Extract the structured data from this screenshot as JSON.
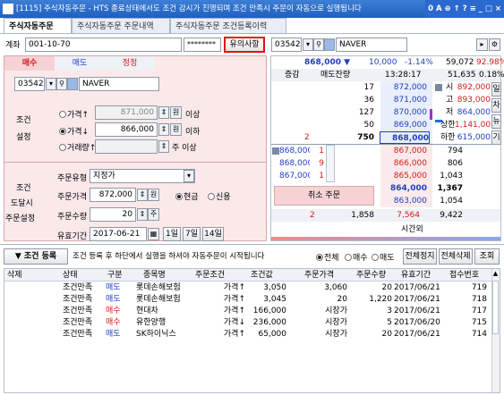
{
  "window": {
    "title": "[1115] 주식자동주문 - HTS 종료상태에서도 조건 감시가 진행되며 조건 만족시 주문이 자동으로 실행됩니다",
    "controls": "0 A ⊕ ↑ ? ≡ _ □ ×"
  },
  "tabs": [
    "주식자동주문",
    "주식자동주문 주문내역",
    "주식자동주문 조건등록이력"
  ],
  "account": {
    "label": "계좌",
    "number": "001-10-70",
    "password": "********",
    "notice_button": "유의사항"
  },
  "right_top": {
    "code": "035420",
    "name": "NAVER"
  },
  "order_tabs": [
    "매수",
    "매도",
    "정정"
  ],
  "left_code": {
    "code": "035420",
    "name": "NAVER"
  },
  "condition": {
    "label1": "조건",
    "label2": "설정",
    "rows": [
      {
        "radio": "가격↑",
        "value": "871,000",
        "unit": "원",
        "suffix": "이상",
        "selected": false
      },
      {
        "radio": "가격↓",
        "value": "866,000",
        "unit": "원",
        "suffix": "이하",
        "selected": true
      },
      {
        "radio": "거래량↑",
        "value": "",
        "unit": "",
        "suffix": "주 이상",
        "selected": false
      }
    ]
  },
  "order": {
    "label1": "조건",
    "label2": "도달시",
    "label3": "주문설정",
    "type_label": "주문유형",
    "type_value": "지정가",
    "price_label": "주문가격",
    "price_value": "872,000",
    "price_unit": "원",
    "cash": "현금",
    "credit": "신용",
    "qty_label": "주문수량",
    "qty_value": "20",
    "qty_unit": "주",
    "valid_label": "유효기간",
    "valid_value": "2017-06-21",
    "d1": "1일",
    "d7": "7일",
    "d14": "14일"
  },
  "quote": {
    "price": "868,000",
    "arrow": "▼",
    "change": "10,000",
    "rate": "-1.14%",
    "volume": "59,072",
    "ratio": "92.98%",
    "hdr": [
      "증감",
      "매도잔량",
      "13:28:17",
      "51,635",
      "0.18%"
    ],
    "asks": [
      {
        "qty": "17",
        "price": "872,000"
      },
      {
        "qty": "36",
        "price": "871,000"
      },
      {
        "qty": "127",
        "price": "870,000"
      },
      {
        "qty": "50",
        "price": "869,000"
      },
      {
        "qty": "750",
        "price": "868,000",
        "inc": "2"
      }
    ],
    "info": [
      {
        "k": "시",
        "v": "892,000"
      },
      {
        "k": "고",
        "v": "893,000"
      },
      {
        "k": "저",
        "v": "864,000"
      },
      {
        "k": "상한",
        "v": "1,141,000"
      },
      {
        "k": "하한",
        "v": "615,000"
      }
    ],
    "side_tabs": [
      "일",
      "차",
      "뉴",
      "기"
    ],
    "trades": [
      {
        "p": "868,000",
        "q": "1"
      },
      {
        "p": "868,000",
        "q": "9"
      },
      {
        "p": "867,000",
        "q": "1"
      }
    ],
    "bids": [
      {
        "price": "867,000",
        "qty": "794"
      },
      {
        "price": "866,000",
        "qty": "806"
      },
      {
        "price": "865,000",
        "qty": "1,043"
      },
      {
        "price": "864,000",
        "qty": "1,367"
      },
      {
        "price": "863,000",
        "qty": "1,054"
      }
    ],
    "cancel_button": "취소 주문",
    "foot": {
      "inc": "2",
      "ask_total": "1,858",
      "diff": "7,564",
      "bid_total": "9,422",
      "after": "시간외"
    }
  },
  "register": {
    "title": "▼ 조건 등록",
    "desc": "조건 등록 후 하단에서 실행을 하셔야 자동주문이 시작됩니다",
    "filters": [
      "전체",
      "매수",
      "매도"
    ],
    "stop": "전체정지",
    "del": "전체삭제",
    "query": "조회"
  },
  "table": {
    "headers": [
      "삭제",
      "상태",
      "구분",
      "종목명",
      "주문조건",
      "조건값",
      "주문가격",
      "주문수량",
      "유효기간",
      "접수번호"
    ],
    "rows": [
      [
        "",
        "조건만족",
        "매도",
        "롯데손해보험",
        "가격↑",
        "3,050",
        "3,060",
        "20",
        "2017/06/21",
        "719"
      ],
      [
        "",
        "조건만족",
        "매도",
        "롯데손해보험",
        "가격↑",
        "3,045",
        "20",
        "1,220",
        "2017/06/21",
        "718"
      ],
      [
        "",
        "조건만족",
        "매수",
        "현대차",
        "가격↑",
        "166,000",
        "시장가",
        "3",
        "2017/06/21",
        "717"
      ],
      [
        "",
        "조건만족",
        "매수",
        "유한양행",
        "가격↓",
        "236,000",
        "시장가",
        "5",
        "2017/06/20",
        "715"
      ],
      [
        "",
        "조건만족",
        "매도",
        "SK하이닉스",
        "가격↑",
        "65,000",
        "시장가",
        "20",
        "2017/06/21",
        "714"
      ]
    ]
  },
  "colors": {
    "buy": "#d41a1a",
    "sell": "#1f3fbf",
    "panel_pink": "#fbe9ea"
  }
}
